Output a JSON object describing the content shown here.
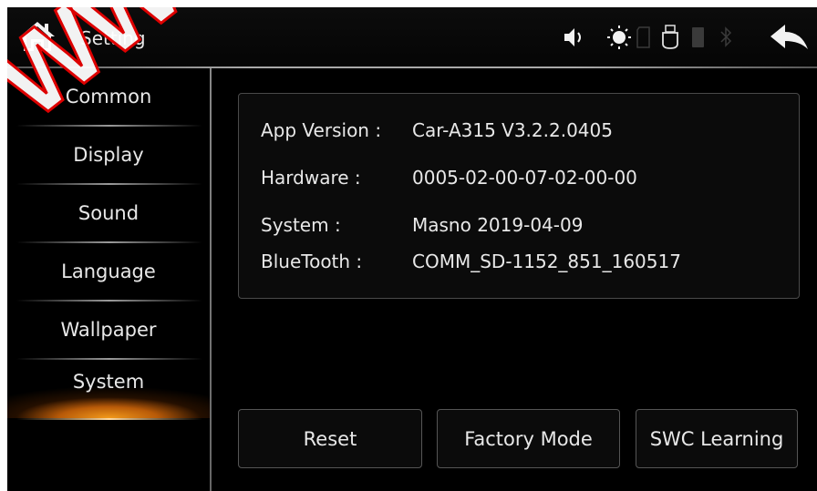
{
  "header": {
    "title": "Setting"
  },
  "status_icons": [
    "volume-icon",
    "brightness-icon",
    "sd-card-icon",
    "usb-icon",
    "phone-icon",
    "bluetooth-icon"
  ],
  "watermark_text": "WW",
  "sidebar": {
    "items": [
      {
        "label": "Common"
      },
      {
        "label": "Display"
      },
      {
        "label": "Sound"
      },
      {
        "label": "Language"
      },
      {
        "label": "Wallpaper"
      },
      {
        "label": "System",
        "active": true
      }
    ]
  },
  "info": {
    "rows": [
      {
        "label": "App Version :",
        "value": "Car-A315 V3.2.2.0405"
      },
      {
        "label": "Hardware :",
        "value": "0005-02-00-07-02-00-00"
      },
      {
        "label": "System :",
        "value": "Masno 2019-04-09"
      },
      {
        "label": "BlueTooth :",
        "value": "COMM_SD-1152_851_160517"
      }
    ]
  },
  "buttons": {
    "reset": "Reset",
    "factory_mode": "Factory Mode",
    "swc_learning": "SWC Learning"
  },
  "colors": {
    "active_accent": "#f39a1a",
    "background": "#000000",
    "text": "#e8e8e8"
  }
}
